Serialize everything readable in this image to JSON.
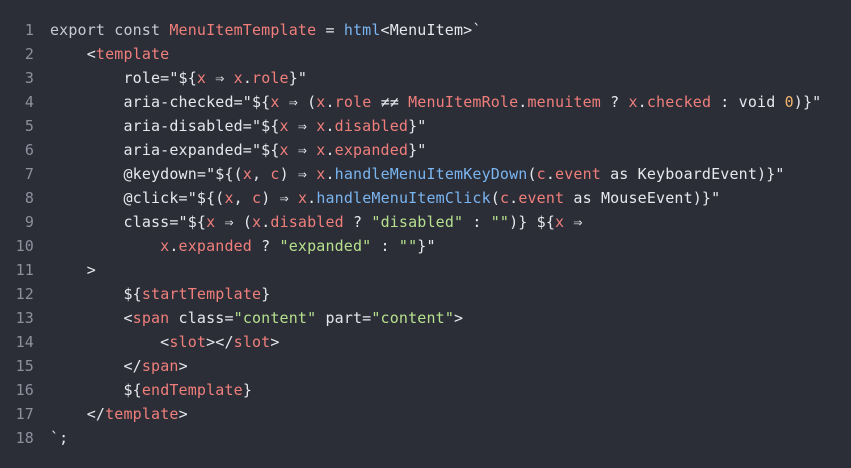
{
  "theme": {
    "background": "#2b2d37",
    "line_number": "#8e919d",
    "plain": "#e6e8ee",
    "red": "#f07f7b",
    "blue": "#7ab5f0",
    "green": "#b6e08d",
    "orange": "#f2b56b"
  },
  "lines": [
    {
      "n": "1",
      "indent": "",
      "tokens": [
        {
          "t": "export const ",
          "c": "kw"
        },
        {
          "t": "MenuItemTemplate",
          "c": "red"
        },
        {
          "t": " = ",
          "c": "pl"
        },
        {
          "t": "html",
          "c": "blue"
        },
        {
          "t": "<MenuItem>`",
          "c": "pl"
        }
      ]
    },
    {
      "n": "2",
      "indent": "    ",
      "tokens": [
        {
          "t": "<",
          "c": "pl"
        },
        {
          "t": "template",
          "c": "red"
        }
      ]
    },
    {
      "n": "3",
      "indent": "        ",
      "tokens": [
        {
          "t": "role=\"${",
          "c": "pl"
        },
        {
          "t": "x",
          "c": "red"
        },
        {
          "t": " ⇒ ",
          "c": "pl"
        },
        {
          "t": "x",
          "c": "red"
        },
        {
          "t": ".",
          "c": "pl"
        },
        {
          "t": "role",
          "c": "red"
        },
        {
          "t": "}\"",
          "c": "pl"
        }
      ]
    },
    {
      "n": "4",
      "indent": "        ",
      "tokens": [
        {
          "t": "aria-checked=\"${",
          "c": "pl"
        },
        {
          "t": "x",
          "c": "red"
        },
        {
          "t": " ⇒ (",
          "c": "pl"
        },
        {
          "t": "x",
          "c": "red"
        },
        {
          "t": ".",
          "c": "pl"
        },
        {
          "t": "role",
          "c": "red"
        },
        {
          "t": " ≠≠ ",
          "c": "pl"
        },
        {
          "t": "MenuItemRole",
          "c": "red"
        },
        {
          "t": ".",
          "c": "pl"
        },
        {
          "t": "menuitem",
          "c": "red"
        },
        {
          "t": " ? ",
          "c": "pl"
        },
        {
          "t": "x",
          "c": "red"
        },
        {
          "t": ".",
          "c": "pl"
        },
        {
          "t": "checked",
          "c": "red"
        },
        {
          "t": " : void ",
          "c": "pl"
        },
        {
          "t": "0",
          "c": "orange"
        },
        {
          "t": ")}\"",
          "c": "pl"
        }
      ]
    },
    {
      "n": "5",
      "indent": "        ",
      "tokens": [
        {
          "t": "aria-disabled=\"${",
          "c": "pl"
        },
        {
          "t": "x",
          "c": "red"
        },
        {
          "t": " ⇒ ",
          "c": "pl"
        },
        {
          "t": "x",
          "c": "red"
        },
        {
          "t": ".",
          "c": "pl"
        },
        {
          "t": "disabled",
          "c": "red"
        },
        {
          "t": "}\"",
          "c": "pl"
        }
      ]
    },
    {
      "n": "6",
      "indent": "        ",
      "tokens": [
        {
          "t": "aria-expanded=\"${",
          "c": "pl"
        },
        {
          "t": "x",
          "c": "red"
        },
        {
          "t": " ⇒ ",
          "c": "pl"
        },
        {
          "t": "x",
          "c": "red"
        },
        {
          "t": ".",
          "c": "pl"
        },
        {
          "t": "expanded",
          "c": "red"
        },
        {
          "t": "}\"",
          "c": "pl"
        }
      ]
    },
    {
      "n": "7",
      "indent": "        ",
      "tokens": [
        {
          "t": "@keydown=\"${(",
          "c": "pl"
        },
        {
          "t": "x",
          "c": "red"
        },
        {
          "t": ", ",
          "c": "pl"
        },
        {
          "t": "c",
          "c": "red"
        },
        {
          "t": ") ⇒ ",
          "c": "pl"
        },
        {
          "t": "x",
          "c": "red"
        },
        {
          "t": ".",
          "c": "pl"
        },
        {
          "t": "handleMenuItemKeyDown",
          "c": "blue"
        },
        {
          "t": "(",
          "c": "pl"
        },
        {
          "t": "c",
          "c": "red"
        },
        {
          "t": ".",
          "c": "pl"
        },
        {
          "t": "event",
          "c": "red"
        },
        {
          "t": " as KeyboardEvent)}\"",
          "c": "pl"
        }
      ]
    },
    {
      "n": "8",
      "indent": "        ",
      "tokens": [
        {
          "t": "@click=\"${(",
          "c": "pl"
        },
        {
          "t": "x",
          "c": "red"
        },
        {
          "t": ", ",
          "c": "pl"
        },
        {
          "t": "c",
          "c": "red"
        },
        {
          "t": ") ⇒ ",
          "c": "pl"
        },
        {
          "t": "x",
          "c": "red"
        },
        {
          "t": ".",
          "c": "pl"
        },
        {
          "t": "handleMenuItemClick",
          "c": "blue"
        },
        {
          "t": "(",
          "c": "pl"
        },
        {
          "t": "c",
          "c": "red"
        },
        {
          "t": ".",
          "c": "pl"
        },
        {
          "t": "event",
          "c": "red"
        },
        {
          "t": " as MouseEvent)}\"",
          "c": "pl"
        }
      ]
    },
    {
      "n": "9",
      "indent": "        ",
      "tokens": [
        {
          "t": "class=\"${",
          "c": "pl"
        },
        {
          "t": "x",
          "c": "red"
        },
        {
          "t": " ⇒ (",
          "c": "pl"
        },
        {
          "t": "x",
          "c": "red"
        },
        {
          "t": ".",
          "c": "pl"
        },
        {
          "t": "disabled",
          "c": "red"
        },
        {
          "t": " ? ",
          "c": "pl"
        },
        {
          "t": "\"disabled\"",
          "c": "green"
        },
        {
          "t": " : ",
          "c": "pl"
        },
        {
          "t": "\"\"",
          "c": "green"
        },
        {
          "t": ")} ${",
          "c": "pl"
        },
        {
          "t": "x",
          "c": "red"
        },
        {
          "t": " ⇒",
          "c": "pl"
        }
      ]
    },
    {
      "n": "10",
      "indent": "            ",
      "tokens": [
        {
          "t": "x",
          "c": "red"
        },
        {
          "t": ".",
          "c": "pl"
        },
        {
          "t": "expanded",
          "c": "red"
        },
        {
          "t": " ? ",
          "c": "pl"
        },
        {
          "t": "\"expanded\"",
          "c": "green"
        },
        {
          "t": " : ",
          "c": "pl"
        },
        {
          "t": "\"\"",
          "c": "green"
        },
        {
          "t": "}\"",
          "c": "pl"
        }
      ]
    },
    {
      "n": "11",
      "indent": "    ",
      "tokens": [
        {
          "t": ">",
          "c": "pl"
        }
      ]
    },
    {
      "n": "12",
      "indent": "        ",
      "tokens": [
        {
          "t": "${",
          "c": "pl"
        },
        {
          "t": "startTemplate",
          "c": "red"
        },
        {
          "t": "}",
          "c": "pl"
        }
      ]
    },
    {
      "n": "13",
      "indent": "        ",
      "tokens": [
        {
          "t": "<",
          "c": "pl"
        },
        {
          "t": "span",
          "c": "red"
        },
        {
          "t": " class=",
          "c": "pl"
        },
        {
          "t": "\"content\"",
          "c": "green"
        },
        {
          "t": " part=",
          "c": "pl"
        },
        {
          "t": "\"content\"",
          "c": "green"
        },
        {
          "t": ">",
          "c": "pl"
        }
      ]
    },
    {
      "n": "14",
      "indent": "            ",
      "tokens": [
        {
          "t": "<",
          "c": "pl"
        },
        {
          "t": "slot",
          "c": "red"
        },
        {
          "t": "></",
          "c": "pl"
        },
        {
          "t": "slot",
          "c": "red"
        },
        {
          "t": ">",
          "c": "pl"
        }
      ]
    },
    {
      "n": "15",
      "indent": "        ",
      "tokens": [
        {
          "t": "</",
          "c": "pl"
        },
        {
          "t": "span",
          "c": "red"
        },
        {
          "t": ">",
          "c": "pl"
        }
      ]
    },
    {
      "n": "16",
      "indent": "        ",
      "tokens": [
        {
          "t": "${",
          "c": "pl"
        },
        {
          "t": "endTemplate",
          "c": "red"
        },
        {
          "t": "}",
          "c": "pl"
        }
      ]
    },
    {
      "n": "17",
      "indent": "    ",
      "tokens": [
        {
          "t": "</",
          "c": "pl"
        },
        {
          "t": "template",
          "c": "red"
        },
        {
          "t": ">",
          "c": "pl"
        }
      ]
    },
    {
      "n": "18",
      "indent": "",
      "tokens": [
        {
          "t": "`;",
          "c": "pl"
        }
      ]
    }
  ]
}
